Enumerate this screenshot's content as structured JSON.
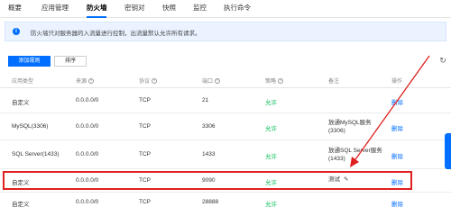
{
  "tabs": [
    "概要",
    "应用管理",
    "防火墙",
    "密钥对",
    "快照",
    "监控",
    "执行命令"
  ],
  "banner": {
    "text": "防火墙只对服务器的入流量进行控制，出流量默认允许所有请求。"
  },
  "toolbar": {
    "add_label": "添加规则",
    "sort_label": "排序"
  },
  "columns": [
    "应用类型",
    "来源",
    "协议",
    "端口",
    "策略",
    "备注",
    "操作"
  ],
  "rows": [
    {
      "type": "自定义",
      "source": "0.0.0.0/0",
      "protocol": "TCP",
      "port": "21",
      "policy": "允许",
      "note": "",
      "action": "删除"
    },
    {
      "type": "MySQL(3306)",
      "source": "0.0.0.0/0",
      "protocol": "TCP",
      "port": "3306",
      "policy": "允许",
      "note": "放通MySQL服务\n(3306)",
      "action": "删除"
    },
    {
      "type": "SQL Server(1433)",
      "source": "0.0.0.0/0",
      "protocol": "TCP",
      "port": "1433",
      "policy": "允许",
      "note": "放通SQL Server服务\n(1433)",
      "action": "删除"
    },
    {
      "type": "自定义",
      "source": "0.0.0.0/0",
      "protocol": "TCP",
      "port": "9090",
      "policy": "允许",
      "note": "测试",
      "action": "删除"
    },
    {
      "type": "自定义",
      "source": "0.0.0.0/0",
      "protocol": "TCP",
      "port": "28888",
      "policy": "允许",
      "note": "",
      "action": "删除"
    }
  ],
  "colors": {
    "accent": "#006eff",
    "allow": "#0abf5b",
    "highlight": "#e02020"
  }
}
